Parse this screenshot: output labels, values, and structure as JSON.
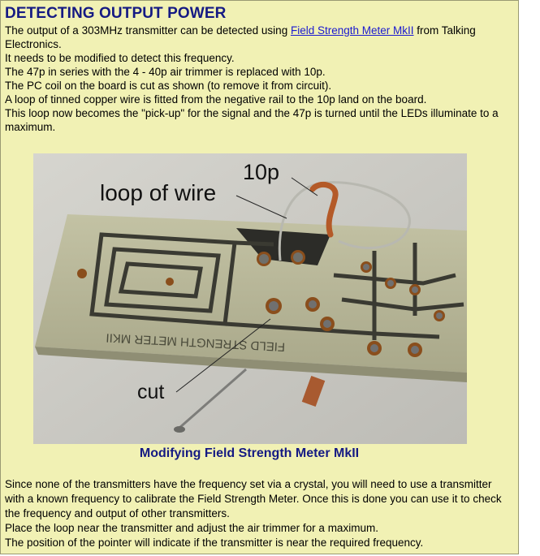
{
  "title": "DETECTING OUTPUT POWER",
  "intro": {
    "l1_pre": "The output of a 303MHz transmitter can be detected using ",
    "l1_link": "Field Strength Meter MkII",
    "l1_post": " from Talking Electronics.",
    "l2": "It needs to be modified to detect this frequency.",
    "l3": "The 47p in series with the 4 - 40p air trimmer is replaced with 10p.",
    "l4": "The PC coil on the board is cut as shown (to remove it from circuit).",
    "l5": "A loop of tinned copper wire is fitted from the negative rail to the 10p land on the board.",
    "l6": "This loop now becomes the \"pick-up\" for the signal and the 47p is turned until the LEDs illuminate to a maximum."
  },
  "photo": {
    "label_loop": "loop of wire",
    "label_10p": "10p",
    "label_cut": "cut",
    "board_text": "FIELD STRENGTH METER MKII"
  },
  "caption": "Modifying Field Strength Meter MkII",
  "body2": {
    "p1": "Since none of the transmitters have the frequency set via a crystal, you will need to use a transmitter with a known frequency to calibrate the Field Strength Meter. Once this is done you can use it to check the frequency and output of other transmitters.",
    "p2": "Place the loop near the transmitter and adjust the air trimmer for a maximum.",
    "p3": "The position of the pointer will indicate if the transmitter is near the required frequency."
  },
  "colors": {
    "panel_bg": "#f1f1b4",
    "heading": "#151a83",
    "link": "#1b1ad0"
  }
}
